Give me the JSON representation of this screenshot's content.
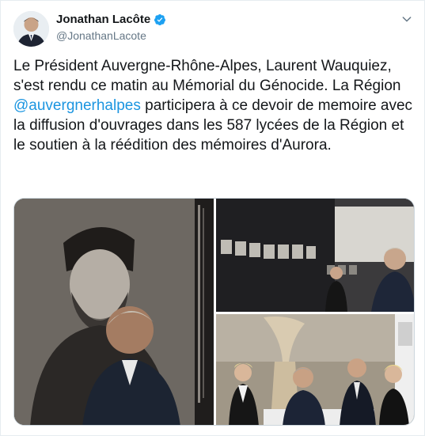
{
  "author": {
    "display_name": "Jonathan Lacôte",
    "handle": "@JonathanLacote",
    "verified": true,
    "avatar_icon": "avatar-portrait"
  },
  "menu": {
    "icon": "chevron-down-icon"
  },
  "tweet": {
    "text_before_mention": "Le Président Auvergne-Rhône-Alpes, Laurent Wauquiez, s'est rendu ce matin au Mémorial du Génocide. La Région ",
    "mention": "@auvergnerhalpes",
    "text_after_mention": " participera à ce devoir de memoire avec la diffusion d'ouvrages dans les 587 lycées de la Région et le soutien à la réédition des mémoires d'Aurora."
  },
  "media": {
    "photo_count": 3,
    "colors": {
      "link": "#1b95e0",
      "verified": "#1da1f2",
      "secondary_text": "#657786"
    }
  }
}
